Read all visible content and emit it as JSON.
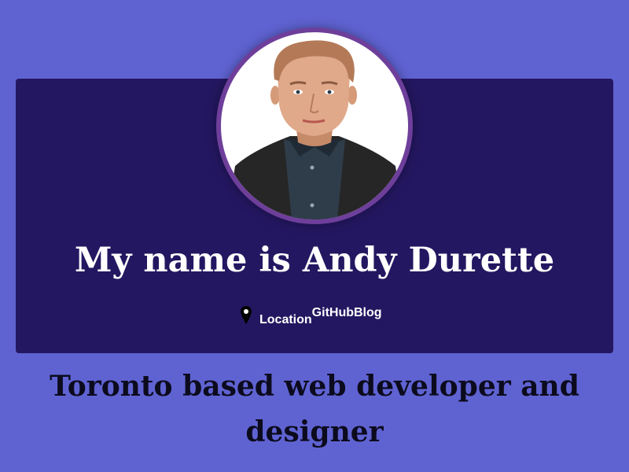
{
  "profile": {
    "heading": "My name is Andy Durette",
    "links": {
      "icon": "map-pin-icon",
      "location": "Location",
      "github": "GitHub",
      "blog": "Blog"
    },
    "tagline": "Toronto based web developer and designer"
  },
  "colors": {
    "page_background": "#5f63d2",
    "card_background": "#241761",
    "avatar_ring": "#6e3f9a",
    "heading_text": "#ffffff",
    "tagline_text": "#0c0b1e"
  }
}
